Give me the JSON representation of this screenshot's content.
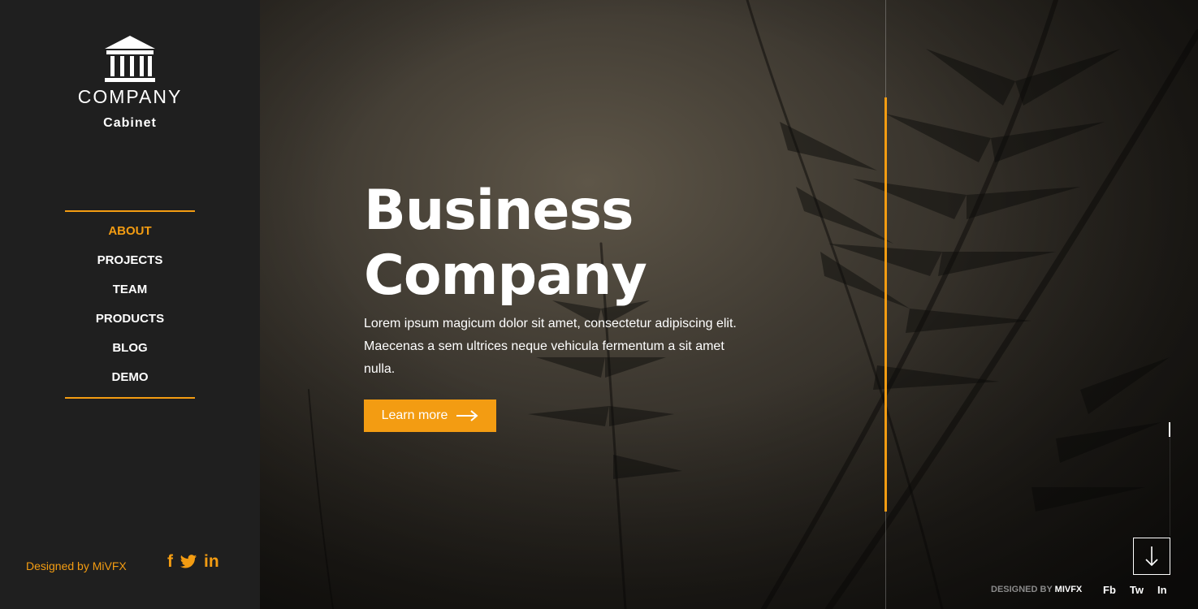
{
  "sidebar": {
    "brand": "COMPANY",
    "brand_sub": "Cabinet",
    "logo_icon": "bank-building-icon",
    "nav": [
      {
        "label": "ABOUT",
        "active": true
      },
      {
        "label": "PROJECTS",
        "active": false
      },
      {
        "label": "TEAM",
        "active": false
      },
      {
        "label": "PRODUCTS",
        "active": false
      },
      {
        "label": "BLOG",
        "active": false
      },
      {
        "label": "DEMO",
        "active": false
      }
    ],
    "designed_by": "Designed by MiVFX",
    "social": [
      {
        "icon": "facebook-icon",
        "glyph": "f"
      },
      {
        "icon": "twitter-icon",
        "glyph": "bird"
      },
      {
        "icon": "linkedin-icon",
        "glyph": "in"
      }
    ]
  },
  "hero": {
    "title_line1": "Business",
    "title_line2": "Company",
    "description": "Lorem ipsum magicum dolor sit amet, consectetur adipiscing elit. Maecenas a sem ultrices neque vehicula fermentum a sit amet nulla.",
    "button_label": "Learn more",
    "button_icon": "arrow-right-icon"
  },
  "footer": {
    "designed_prefix": "DESIGNED BY ",
    "designed_brand": "MIVFX",
    "links": [
      "Fb",
      "Tw",
      "In"
    ],
    "scroll_icon": "arrow-down-icon"
  },
  "colors": {
    "accent": "#f39c12",
    "sidebar_bg": "#1f1f1f"
  }
}
